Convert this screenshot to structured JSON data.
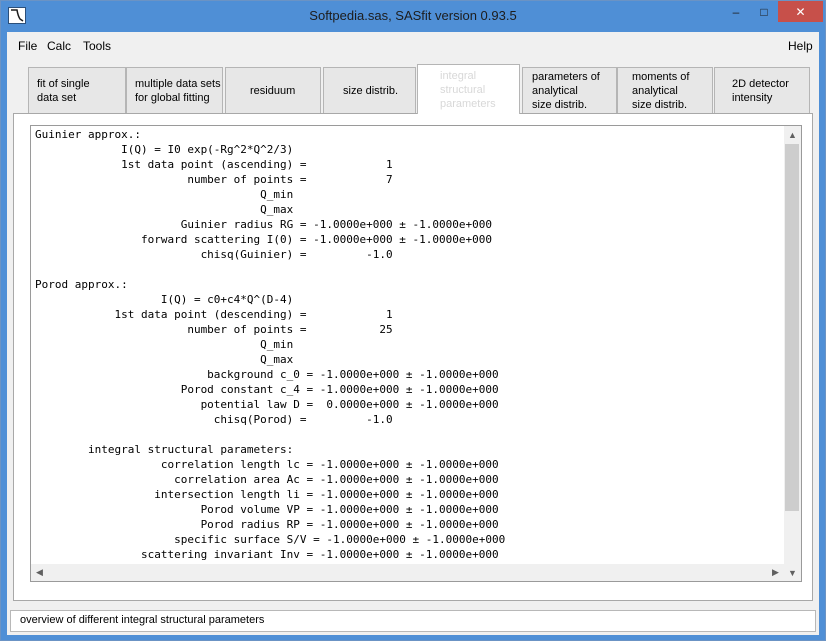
{
  "window": {
    "title": "Softpedia.sas, SASfit version 0.93.5",
    "minimize_label": "–",
    "maximize_label": "□",
    "close_label": "✕"
  },
  "menu": {
    "file": "File",
    "calc": "Calc",
    "tools": "Tools",
    "help": "Help"
  },
  "tabs": [
    {
      "label": "fit of single\ndata set",
      "active": false
    },
    {
      "label": "multiple data sets\nfor global fitting",
      "active": false
    },
    {
      "label": "residuum",
      "active": false
    },
    {
      "label": "size distrib.",
      "active": false
    },
    {
      "label": "integral\nstructural\nparameters",
      "active": true
    },
    {
      "label": "parameters of\nanalytical\nsize distrib.",
      "active": false
    },
    {
      "label": "moments of\nanalytical\nsize distrib.",
      "active": false
    },
    {
      "label": "2D detector\nintensity",
      "active": false
    }
  ],
  "content": {
    "lines": [
      "Guinier approx.:",
      "             I(Q) = I0 exp(-Rg^2*Q^2/3)",
      "             1st data point (ascending) =            1",
      "                       number of points =            7",
      "                                  Q_min",
      "                                  Q_max",
      "                      Guinier radius RG = -1.0000e+000 ± -1.0000e+000",
      "                forward scattering I(0) = -1.0000e+000 ± -1.0000e+000",
      "                         chisq(Guinier) =         -1.0",
      "",
      "Porod approx.:",
      "                   I(Q) = c0+c4*Q^(D-4)",
      "            1st data point (descending) =            1",
      "                       number of points =           25",
      "                                  Q_min",
      "                                  Q_max",
      "                          background c_0 = -1.0000e+000 ± -1.0000e+000",
      "                      Porod constant c_4 = -1.0000e+000 ± -1.0000e+000",
      "                         potential law D =  0.0000e+000 ± -1.0000e+000",
      "                           chisq(Porod) =         -1.0",
      "",
      "        integral structural parameters:",
      "                   correlation length lc = -1.0000e+000 ± -1.0000e+000",
      "                     correlation area Ac = -1.0000e+000 ± -1.0000e+000",
      "                  intersection length li = -1.0000e+000 ± -1.0000e+000",
      "                         Porod volume VP = -1.0000e+000 ± -1.0000e+000",
      "                         Porod radius RP = -1.0000e+000 ± -1.0000e+000",
      "                     specific surface S/V = -1.0000e+000 ± -1.0000e+000",
      "                scattering invariant Inv = -1.0000e+000 ± -1.0000e+000"
    ]
  },
  "scroll": {
    "up_arrow": "▲",
    "down_arrow": "▼",
    "left_arrow": "◀",
    "right_arrow": "▶"
  },
  "status": {
    "text": "overview of different integral structural parameters"
  }
}
